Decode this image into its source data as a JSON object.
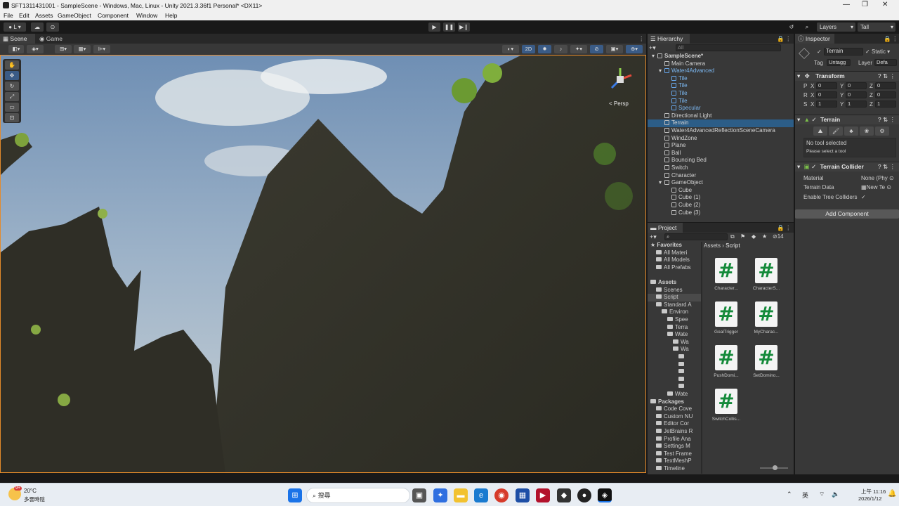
{
  "window": {
    "title": "SFT1311431001 - SampleScene - Windows, Mac, Linux - Unity 2021.3.36f1 Personal* <DX11>",
    "min": "—",
    "max": "❐",
    "close": "✕"
  },
  "menu": [
    "File",
    "Edit",
    "Assets",
    "GameObject",
    "Component",
    "Window",
    "Help"
  ],
  "toolbar": {
    "account": "L",
    "play_icon": "play-icon",
    "layers": "Layers",
    "layout": "Tall"
  },
  "scene": {
    "tabs": [
      "Scene",
      "Game"
    ],
    "mode2d": "2D",
    "persp": "< Persp"
  },
  "hierarchy": {
    "title": "Hierarchy",
    "search": "All",
    "items": [
      {
        "label": "SampleScene*",
        "depth": 0,
        "kind": "scene",
        "open": true
      },
      {
        "label": "Main Camera",
        "depth": 1
      },
      {
        "label": "Water4Advanced",
        "depth": 1,
        "prefab": true,
        "open": true
      },
      {
        "label": "Tile",
        "depth": 2,
        "prefab": true
      },
      {
        "label": "Tile",
        "depth": 2,
        "prefab": true
      },
      {
        "label": "Tile",
        "depth": 2,
        "prefab": true
      },
      {
        "label": "Tile",
        "depth": 2,
        "prefab": true
      },
      {
        "label": "Specular",
        "depth": 2,
        "prefab": true
      },
      {
        "label": "Directional Light",
        "depth": 1
      },
      {
        "label": "Terrain",
        "depth": 1,
        "selected": true
      },
      {
        "label": "Water4AdvancedReflectionSceneCamera",
        "depth": 1
      },
      {
        "label": "WindZone",
        "depth": 1
      },
      {
        "label": "Plane",
        "depth": 1
      },
      {
        "label": "Ball",
        "depth": 1
      },
      {
        "label": "Bouncing Bed",
        "depth": 1
      },
      {
        "label": "Switch",
        "depth": 1
      },
      {
        "label": "Character",
        "depth": 1
      },
      {
        "label": "GameObject",
        "depth": 1,
        "open": true
      },
      {
        "label": "Cube",
        "depth": 2
      },
      {
        "label": "Cube (1)",
        "depth": 2
      },
      {
        "label": "Cube (2)",
        "depth": 2
      },
      {
        "label": "Cube (3)",
        "depth": 2
      }
    ]
  },
  "project": {
    "title": "Project",
    "count": "14",
    "breadcrumb": [
      "Assets",
      "Script"
    ],
    "tree": [
      {
        "label": "Favorites",
        "depth": 0,
        "bold": true,
        "star": true
      },
      {
        "label": "All Materi",
        "depth": 1
      },
      {
        "label": "All Models",
        "depth": 1
      },
      {
        "label": "All Prefabs",
        "depth": 1
      },
      {
        "label": "",
        "depth": 0
      },
      {
        "label": "Assets",
        "depth": 0,
        "bold": true
      },
      {
        "label": "Scenes",
        "depth": 1
      },
      {
        "label": "Script",
        "depth": 1,
        "selected": true
      },
      {
        "label": "Standard A",
        "depth": 1
      },
      {
        "label": "Environ",
        "depth": 2
      },
      {
        "label": "Spee",
        "depth": 3
      },
      {
        "label": "Terra",
        "depth": 3
      },
      {
        "label": "Wate",
        "depth": 3
      },
      {
        "label": "Wa",
        "depth": 4
      },
      {
        "label": "Wa",
        "depth": 4
      },
      {
        "label": "",
        "depth": 5
      },
      {
        "label": "",
        "depth": 5
      },
      {
        "label": "",
        "depth": 5
      },
      {
        "label": "",
        "depth": 5
      },
      {
        "label": "",
        "depth": 5
      },
      {
        "label": "Wate",
        "depth": 3
      },
      {
        "label": "Packages",
        "depth": 0,
        "bold": true
      },
      {
        "label": "Code Cove",
        "depth": 1
      },
      {
        "label": "Custom NU",
        "depth": 1
      },
      {
        "label": "Editor Cor",
        "depth": 1
      },
      {
        "label": "JetBrains R",
        "depth": 1
      },
      {
        "label": "Profile Ana",
        "depth": 1
      },
      {
        "label": "Settings M",
        "depth": 1
      },
      {
        "label": "Test Frame",
        "depth": 1
      },
      {
        "label": "TextMeshP",
        "depth": 1
      },
      {
        "label": "Timeline",
        "depth": 1
      }
    ],
    "scripts": [
      "Character...",
      "CharacterS...",
      "GoalTrigger",
      "MyCharac...",
      "PushDomi...",
      "SetDomino...",
      "SwitchCollis..."
    ],
    "script_glyph": "#"
  },
  "inspector": {
    "title": "Inspector",
    "object_name": "Terrain",
    "static": "Static",
    "tag_label": "Tag",
    "tag": "Untagg",
    "layer_label": "Layer",
    "layer": "Defa",
    "transform": {
      "title": "Transform",
      "rows": [
        {
          "label": "P",
          "x": "0",
          "y": "0",
          "z": "0"
        },
        {
          "label": "R",
          "x": "0",
          "y": "0",
          "z": "0"
        },
        {
          "label": "S",
          "x": "1",
          "y": "1",
          "z": "1"
        }
      ]
    },
    "terrain": {
      "title": "Terrain",
      "no_tool": "No tool selected",
      "hint": "Please select a tool"
    },
    "collider": {
      "title": "Terrain Collider",
      "material_label": "Material",
      "material": "None (Phy",
      "data_label": "Terrain Data",
      "data": "New Te",
      "trees_label": "Enable Tree Colliders",
      "trees": "✓"
    },
    "add_component": "Add Component"
  },
  "taskbar": {
    "temp": "20°C",
    "weather": "多雲時陰",
    "badge": "9+",
    "search": "搜尋",
    "ime": "英",
    "time": "上午 11:16",
    "date": "2026/1/12"
  }
}
